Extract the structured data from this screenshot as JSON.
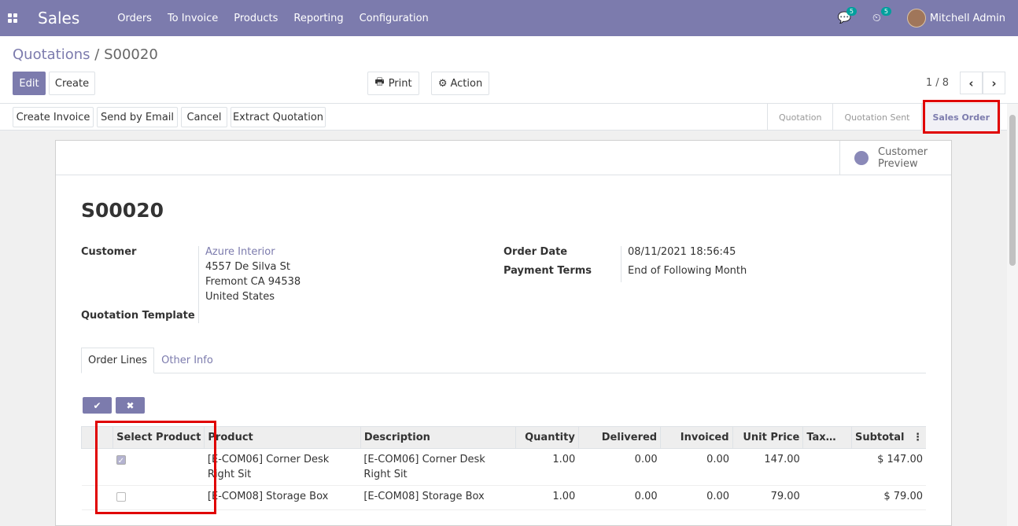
{
  "navbar": {
    "app_name": "Sales",
    "menu": [
      "Orders",
      "To Invoice",
      "Products",
      "Reporting",
      "Configuration"
    ],
    "messages_count": "5",
    "activities_count": "5",
    "user_name": "Mitchell Admin",
    "bg_color": "#7c7bad"
  },
  "breadcrumb": {
    "parent": "Quotations",
    "separator": "/",
    "current": "S00020"
  },
  "buttons": {
    "edit": "Edit",
    "create": "Create",
    "print": "Print",
    "action": "Action"
  },
  "pager": {
    "value": "1 / 8"
  },
  "statusbar": {
    "buttons": [
      "Create Invoice",
      "Send by Email",
      "Cancel",
      "Extract Quotation"
    ],
    "stages": [
      "Quotation",
      "Quotation Sent",
      "Sales Order"
    ],
    "active_stage": "Sales Order"
  },
  "sheet": {
    "customer_preview": "Customer Preview",
    "title": "S00020",
    "customer_label": "Customer",
    "customer_name": "Azure Interior",
    "address_line1": "4557 De Silva St",
    "address_line2": "Fremont CA 94538",
    "address_line3": "United States",
    "quotation_template_label": "Quotation Template",
    "order_date_label": "Order Date",
    "order_date": "08/11/2021 18:56:45",
    "payment_terms_label": "Payment Terms",
    "payment_terms": "End of Following Month"
  },
  "tabs": [
    "Order Lines",
    "Other Info"
  ],
  "table": {
    "headers": [
      "Select Product",
      "Product",
      "Description",
      "Quantity",
      "Delivered",
      "Invoiced",
      "Unit Price",
      "Tax…",
      "Subtotal"
    ],
    "rows": [
      {
        "selected": true,
        "product": "[E-COM06] Corner Desk Right Sit",
        "description": "[E-COM06] Corner Desk Right Sit",
        "quantity": "1.00",
        "delivered": "0.00",
        "invoiced": "0.00",
        "unit_price": "147.00",
        "taxes": "",
        "subtotal": "$ 147.00"
      },
      {
        "selected": false,
        "product": "[E-COM08] Storage Box",
        "description": "[E-COM08] Storage Box",
        "quantity": "1.00",
        "delivered": "0.00",
        "invoiced": "0.00",
        "unit_price": "79.00",
        "taxes": "",
        "subtotal": "$ 79.00"
      }
    ]
  },
  "colors": {
    "accent": "#7c7bad",
    "highlight": "#e00000"
  }
}
